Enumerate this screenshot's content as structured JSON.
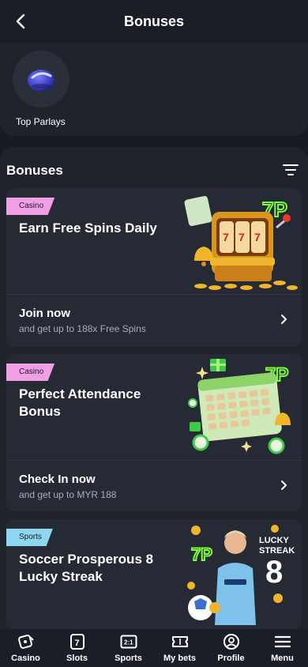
{
  "header": {
    "title": "Bonuses"
  },
  "top_parlays": {
    "label": "Top Parlays",
    "icon": "parlay-ball-icon"
  },
  "bonuses": {
    "title": "Bonuses",
    "cards": [
      {
        "badge": "Casino",
        "title": "Earn Free Spins Daily",
        "cta": "Join now",
        "sub": "and get up to 188x Free Spins"
      },
      {
        "badge": "Casino",
        "title": "Perfect Attendance Bonus",
        "cta": "Check In now",
        "sub": "and get up to MYR 188"
      },
      {
        "badge": "Sports",
        "title": "Soccer Prosperous 8 Lucky Streak"
      }
    ]
  },
  "nav": [
    {
      "label": "Casino",
      "icon": "casino-icon"
    },
    {
      "label": "Slots",
      "icon": "slots-icon"
    },
    {
      "label": "Sports",
      "icon": "sports-icon"
    },
    {
      "label": "My bets",
      "icon": "ticket-icon"
    },
    {
      "label": "Profile",
      "icon": "profile-icon"
    },
    {
      "label": "Menu",
      "icon": "menu-icon"
    }
  ],
  "colors": {
    "background": "#181b22",
    "card": "#262a34",
    "casino_badge": "#f09ee6",
    "sports_badge": "#8fd6f2",
    "accent_green": "#7dfc3a"
  }
}
